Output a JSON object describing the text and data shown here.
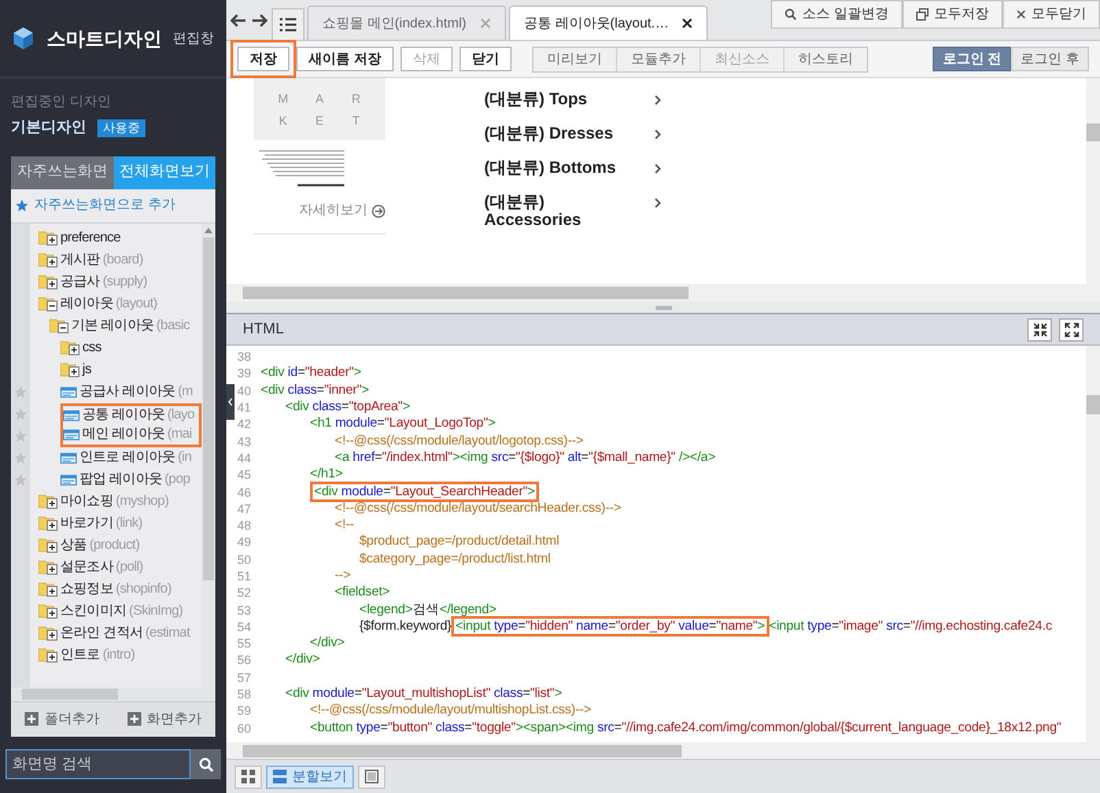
{
  "sidebar": {
    "title": "스마트디자인",
    "subtitle": "편집창",
    "current_label": "편집중인 디자인",
    "current_design": "기본디자인",
    "badge": "사용중",
    "tabs": [
      {
        "label": "자주쓰는화면",
        "selected": false
      },
      {
        "label": "전체화면보기",
        "selected": true
      }
    ],
    "favorite_action": "자주쓰는화면으로 추가",
    "tree": [
      {
        "kind": "folder",
        "name": "preference",
        "expanded": false
      },
      {
        "kind": "folder",
        "name": "게시판",
        "code": "(board)",
        "expanded": false
      },
      {
        "kind": "folder",
        "name": "공급사",
        "code": "(supply)",
        "expanded": false
      },
      {
        "kind": "folder",
        "name": "레이아웃",
        "code": "(layout)",
        "expanded": true,
        "children": [
          {
            "kind": "folder",
            "name": "기본 레이아웃",
            "code": "(basic",
            "expanded": true,
            "children": [
              {
                "kind": "folder",
                "name": "css",
                "expanded": false,
                "highlighted": false
              },
              {
                "kind": "folder",
                "name": "js",
                "expanded": false,
                "highlighted": false
              },
              {
                "kind": "file",
                "name": "공급사 레이아웃",
                "code": "(m",
                "highlighted": false
              },
              {
                "kind": "file",
                "name": "공통 레이아웃",
                "code": "(layo",
                "highlighted": true
              },
              {
                "kind": "file",
                "name": "메인 레이아웃",
                "code": "(mai",
                "highlighted": true
              },
              {
                "kind": "file",
                "name": "인트로 레이아웃",
                "code": "(in",
                "highlighted": false
              },
              {
                "kind": "file",
                "name": "팝업 레이아웃",
                "code": "(pop",
                "highlighted": false
              }
            ]
          }
        ]
      },
      {
        "kind": "folder",
        "name": "마이쇼핑",
        "code": "(myshop)",
        "expanded": false
      },
      {
        "kind": "folder",
        "name": "바로가기",
        "code": "(link)",
        "expanded": false
      },
      {
        "kind": "folder",
        "name": "상품",
        "code": "(product)",
        "expanded": false
      },
      {
        "kind": "folder",
        "name": "설문조사",
        "code": "(poll)",
        "expanded": false
      },
      {
        "kind": "folder",
        "name": "쇼핑정보",
        "code": "(shopinfo)",
        "expanded": false
      },
      {
        "kind": "folder",
        "name": "스킨이미지",
        "code": "(SkinImg)",
        "expanded": false
      },
      {
        "kind": "folder",
        "name": "온라인 견적서",
        "code": "(estimat",
        "expanded": false
      },
      {
        "kind": "folder",
        "name": "인트로",
        "code": "(intro)",
        "expanded": false
      }
    ],
    "buttons": [
      "폴더추가",
      "화면추가"
    ],
    "search": {
      "placeholder": "화면명 검색"
    }
  },
  "tabs": [
    {
      "label": "쇼핑몰 메인(index.html)",
      "selected": false
    },
    {
      "label": "공통 레이아웃(layout.…",
      "selected": true
    }
  ],
  "top_actions": [
    {
      "kind": "search",
      "label": "소스 일괄변경"
    },
    {
      "kind": "window",
      "label": "모두저장"
    },
    {
      "kind": "close",
      "label": "모두닫기"
    }
  ],
  "toolbar": [
    {
      "label": "저장",
      "disabled": false,
      "highlighted": true
    },
    {
      "label": "새이름 저장",
      "disabled": false,
      "highlighted": false
    },
    {
      "label": "삭제",
      "disabled": true,
      "highlighted": false
    },
    {
      "label": "닫기",
      "disabled": false,
      "highlighted": false
    }
  ],
  "view_group": [
    {
      "label": "미리보기",
      "disabled": false
    },
    {
      "label": "모듈추가",
      "disabled": false
    },
    {
      "label": "최신소스",
      "disabled": true
    },
    {
      "label": "히스토리",
      "disabled": false
    }
  ],
  "login_toggle": [
    {
      "label": "로그인 전",
      "selected": true
    },
    {
      "label": "로그인 후",
      "selected": false
    }
  ],
  "preview": {
    "logo_letters": [
      "M",
      "A",
      "R",
      "K",
      "E",
      "T"
    ],
    "more_link": "자세히보기",
    "categories": [
      "(대분류) Tops",
      "(대분류) Dresses",
      "(대분류) Bottoms",
      "(대분류) Accessories"
    ]
  },
  "editor": {
    "title": "HTML",
    "lines": [
      {
        "number": "38"
      },
      {
        "number": "39",
        "tokens": [
          {
            "kind": "tag",
            "text": "<div "
          },
          {
            "kind": "attr",
            "text": "id"
          },
          {
            "kind": "text",
            "text": "="
          },
          {
            "kind": "value",
            "text": "\"header\""
          },
          {
            "kind": "tag",
            "text": ">"
          }
        ]
      },
      {
        "number": "40",
        "tokens": [
          {
            "kind": "tag",
            "text": "<div "
          },
          {
            "kind": "attr",
            "text": "class"
          },
          {
            "kind": "text",
            "text": "="
          },
          {
            "kind": "value",
            "text": "\"inner\""
          },
          {
            "kind": "tag",
            "text": ">"
          }
        ]
      },
      {
        "number": "41",
        "tokens": [
          {
            "kind": "tag",
            "text": "\t<div "
          },
          {
            "kind": "attr",
            "text": "class"
          },
          {
            "kind": "text",
            "text": "="
          },
          {
            "kind": "value",
            "text": "\"topArea\""
          },
          {
            "kind": "tag",
            "text": ">"
          }
        ]
      },
      {
        "number": "42",
        "tokens": [
          {
            "kind": "tag",
            "text": "\t\t<h1 "
          },
          {
            "kind": "attr",
            "text": "module"
          },
          {
            "kind": "text",
            "text": "="
          },
          {
            "kind": "value",
            "text": "\"Layout_LogoTop\""
          },
          {
            "kind": "tag",
            "text": ">"
          }
        ]
      },
      {
        "number": "43",
        "tokens": [
          {
            "kind": "comment",
            "text": "\t\t\t<!--@css(/css/module/layout/logotop.css)-->"
          }
        ]
      },
      {
        "number": "44",
        "tokens": [
          {
            "kind": "tag",
            "text": "\t\t\t<a "
          },
          {
            "kind": "attr",
            "text": "href"
          },
          {
            "kind": "text",
            "text": "="
          },
          {
            "kind": "value",
            "text": "\"/index.html\""
          },
          {
            "kind": "tag",
            "text": "><img "
          },
          {
            "kind": "attr",
            "text": "src"
          },
          {
            "kind": "text",
            "text": "="
          },
          {
            "kind": "value",
            "text": "\"{$logo}\""
          },
          {
            "kind": "attr",
            "text": " alt"
          },
          {
            "kind": "text",
            "text": "="
          },
          {
            "kind": "value",
            "text": "\"{$mall_name}\""
          },
          {
            "kind": "tag",
            "text": " /></a>"
          }
        ]
      },
      {
        "number": "45",
        "tokens": [
          {
            "kind": "tag",
            "text": "\t\t</h1>"
          }
        ]
      },
      {
        "number": "46",
        "tokens": [
          {
            "kind": "box",
            "tokens": [
              {
                "kind": "tag",
                "text": "\t\t<div "
              },
              {
                "kind": "attr",
                "text": "module"
              },
              {
                "kind": "text",
                "text": "="
              },
              {
                "kind": "value",
                "text": "\"Layout_SearchHeader\""
              },
              {
                "kind": "tag",
                "text": ">"
              }
            ]
          }
        ]
      },
      {
        "number": "47",
        "tokens": [
          {
            "kind": "comment",
            "text": "\t\t\t<!--@css(/css/module/layout/searchHeader.css)-->"
          }
        ]
      },
      {
        "number": "48",
        "tokens": [
          {
            "kind": "comment",
            "text": "\t\t\t<!--"
          }
        ]
      },
      {
        "number": "49",
        "tokens": [
          {
            "kind": "comment",
            "text": "\t\t\t\t$product_page=/product/detail.html"
          }
        ]
      },
      {
        "number": "50",
        "tokens": [
          {
            "kind": "comment",
            "text": "\t\t\t\t$category_page=/product/list.html"
          }
        ]
      },
      {
        "number": "51",
        "tokens": [
          {
            "kind": "comment",
            "text": "\t\t\t-->"
          }
        ]
      },
      {
        "number": "52",
        "tokens": [
          {
            "kind": "tag",
            "text": "\t\t\t<fieldset>"
          }
        ]
      },
      {
        "number": "53",
        "tokens": [
          {
            "kind": "tag",
            "text": "\t\t\t\t<legend>"
          },
          {
            "kind": "text",
            "text": "검색"
          },
          {
            "kind": "tag",
            "text": "</legend>"
          }
        ]
      },
      {
        "number": "54",
        "tokens": [
          {
            "kind": "text",
            "text": "\t\t\t\t{$form.keyword}"
          },
          {
            "kind": "box",
            "tokens": [
              {
                "kind": "tag",
                "text": "<input "
              },
              {
                "kind": "attr",
                "text": "type"
              },
              {
                "kind": "text",
                "text": "="
              },
              {
                "kind": "value",
                "text": "\"hidden\""
              },
              {
                "kind": "attr",
                "text": " name"
              },
              {
                "kind": "text",
                "text": "="
              },
              {
                "kind": "value",
                "text": "\"order_by\""
              },
              {
                "kind": "attr",
                "text": " value"
              },
              {
                "kind": "text",
                "text": "="
              },
              {
                "kind": "value",
                "text": "\"name\""
              },
              {
                "kind": "tag",
                "text": ">"
              }
            ]
          },
          {
            "kind": "tag",
            "text": "<input "
          },
          {
            "kind": "attr",
            "text": "type"
          },
          {
            "kind": "text",
            "text": "="
          },
          {
            "kind": "value",
            "text": "\"image\""
          },
          {
            "kind": "attr",
            "text": " src"
          },
          {
            "kind": "text",
            "text": "="
          },
          {
            "kind": "value",
            "text": "\"//img.echosting.cafe24.c"
          }
        ]
      },
      {
        "number": "55",
        "tokens": [
          {
            "kind": "tag",
            "text": "\t\t</div>"
          }
        ]
      },
      {
        "number": "56",
        "tokens": [
          {
            "kind": "tag",
            "text": "\t</div>"
          }
        ]
      },
      {
        "number": "57"
      },
      {
        "number": "58",
        "tokens": [
          {
            "kind": "tag",
            "text": "\t<div "
          },
          {
            "kind": "attr",
            "text": "module"
          },
          {
            "kind": "text",
            "text": "="
          },
          {
            "kind": "value",
            "text": "\"Layout_multishopList\""
          },
          {
            "kind": "attr",
            "text": " class"
          },
          {
            "kind": "text",
            "text": "="
          },
          {
            "kind": "value",
            "text": "\"list\""
          },
          {
            "kind": "tag",
            "text": ">"
          }
        ]
      },
      {
        "number": "59",
        "tokens": [
          {
            "kind": "comment",
            "text": "\t\t<!--@css(/css/module/layout/multishopList.css)-->"
          }
        ]
      },
      {
        "number": "60",
        "tokens": [
          {
            "kind": "tag",
            "text": "\t\t<button "
          },
          {
            "kind": "attr",
            "text": "type"
          },
          {
            "kind": "text",
            "text": "="
          },
          {
            "kind": "value",
            "text": "\"button\""
          },
          {
            "kind": "attr",
            "text": " class"
          },
          {
            "kind": "text",
            "text": "="
          },
          {
            "kind": "value",
            "text": "\"toggle\""
          },
          {
            "kind": "tag",
            "text": "><span><img "
          },
          {
            "kind": "attr",
            "text": "src"
          },
          {
            "kind": "text",
            "text": "="
          },
          {
            "kind": "value",
            "text": "\"//img.cafe24.com/img/common/global/{$current_language_code}_18x12.png\""
          }
        ]
      }
    ]
  },
  "bottom_views": [
    {
      "kind": "grid",
      "selected": false
    },
    {
      "kind": "split",
      "label": "분할보기",
      "selected": true
    },
    {
      "kind": "single",
      "selected": false
    }
  ]
}
